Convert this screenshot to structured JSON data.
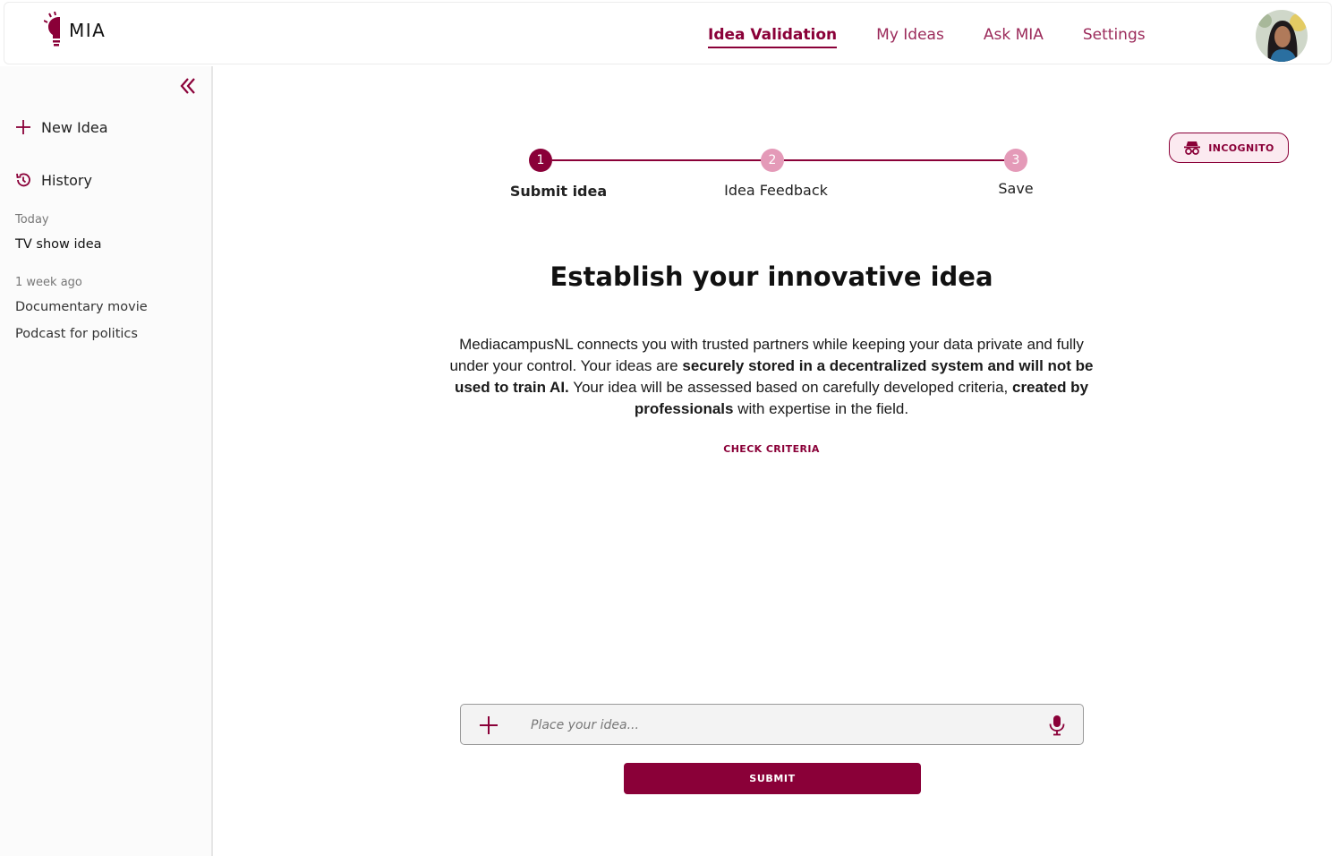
{
  "app": {
    "logo_text": "MIA"
  },
  "nav": {
    "items": [
      {
        "label": "Idea Validation",
        "active": true
      },
      {
        "label": "My Ideas",
        "active": false
      },
      {
        "label": "Ask MIA",
        "active": false
      },
      {
        "label": "Settings",
        "active": false
      }
    ]
  },
  "sidebar": {
    "new_idea": "New Idea",
    "history": "History",
    "groups": [
      {
        "label": "Today",
        "items": [
          "TV show idea"
        ]
      },
      {
        "label": "1 week ago",
        "items": [
          "Documentary movie",
          "Podcast for politics"
        ]
      }
    ]
  },
  "incognito": {
    "label": "INCOGNITO"
  },
  "stepper": {
    "steps": [
      {
        "number": "1",
        "label": "Submit idea",
        "state": "active"
      },
      {
        "number": "2",
        "label": "Idea Feedback",
        "state": "pending"
      },
      {
        "number": "3",
        "label": "Save",
        "state": "pending"
      }
    ]
  },
  "main": {
    "heading": "Establish your innovative idea",
    "description": {
      "p1": "MediacampusNL connects you with trusted partners while keeping your data private and fully under your control. Your ideas are ",
      "b1": "securely stored in a decentralized system and will not be used to train AI.",
      "p2": " Your idea will be assessed based on carefully developed criteria, ",
      "b2": "created by professionals",
      "p3": " with expertise in the field."
    },
    "check_criteria": "CHECK CRITERIA"
  },
  "idea_input": {
    "placeholder": "Place your idea...",
    "value": ""
  },
  "submit": {
    "label": "SUBMIT"
  },
  "colors": {
    "accent": "#8a0038",
    "accent_light": "#e49ab8",
    "incognito_bg": "#fbeaf0"
  },
  "icons": [
    "lightbulb-icon",
    "double-chevron-left-icon",
    "plus-icon",
    "history-icon",
    "incognito-icon",
    "microphone-icon"
  ]
}
